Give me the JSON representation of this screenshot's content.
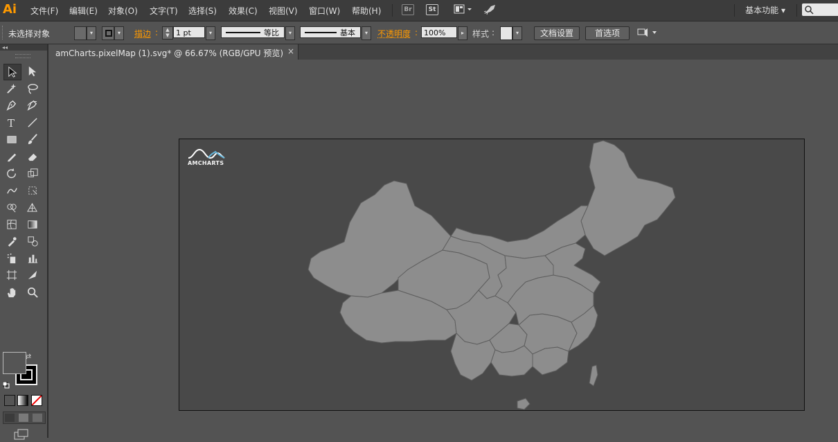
{
  "app": {
    "logo": "Ai"
  },
  "menu": [
    "文件(F)",
    "编辑(E)",
    "对象(O)",
    "文字(T)",
    "选择(S)",
    "效果(C)",
    "视图(V)",
    "窗口(W)",
    "帮助(H)"
  ],
  "top_icons": {
    "bridge": "Br",
    "stock": "St"
  },
  "workspace": {
    "label": "基本功能"
  },
  "control": {
    "selection_label": "未选择对象",
    "stroke_label": "描边",
    "stroke_value": "1 pt",
    "profile_label": "等比",
    "brush_label": "基本",
    "opacity_label": "不透明度",
    "opacity_value": "100%",
    "style_label": "样式",
    "doc_setup": "文档设置",
    "preferences": "首选项"
  },
  "document": {
    "tab_title": "amCharts.pixelMap (1).svg* @ 66.67% (RGB/GPU 预览)",
    "close": "×"
  },
  "artboard": {
    "logo_text": "AMCHARTS",
    "fill": "#494949",
    "map_color": "#8d8d8d",
    "map_stroke": "#5e5e5e"
  },
  "colors": {
    "accent": "#ff9a00",
    "ui_bg": "#535353",
    "menu_bg": "#3c3c3c"
  },
  "tools": [
    "selection-tool",
    "direct-selection-tool",
    "magic-wand-tool",
    "lasso-tool",
    "pen-tool",
    "curvature-tool",
    "type-tool",
    "line-segment-tool",
    "rectangle-tool",
    "paintbrush-tool",
    "pencil-tool",
    "eraser-tool",
    "rotate-tool",
    "scale-tool",
    "warp-tool",
    "free-transform-tool",
    "shape-builder-tool",
    "perspective-grid-tool",
    "mesh-tool",
    "gradient-tool",
    "eyedropper-tool",
    "blend-tool",
    "symbol-sprayer-tool",
    "column-graph-tool",
    "artboard-tool",
    "slice-tool",
    "hand-tool",
    "zoom-tool"
  ]
}
